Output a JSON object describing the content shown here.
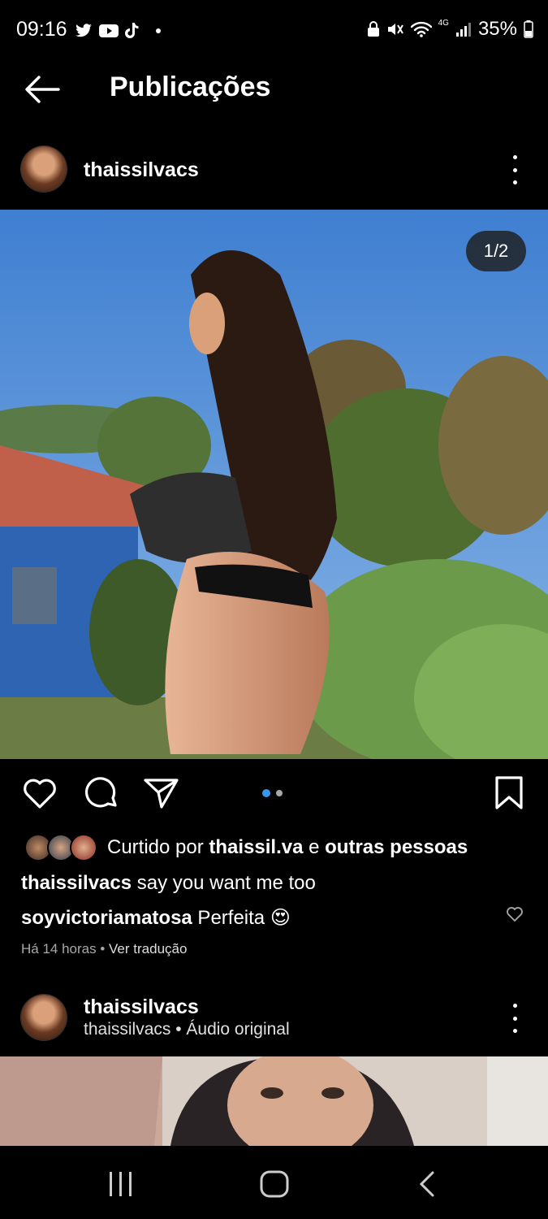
{
  "status_bar": {
    "time": "09:16",
    "battery": "35%",
    "network": "4G"
  },
  "header": {
    "title": "Publicações"
  },
  "post": {
    "username": "thaissilvacs",
    "image_counter": "1/2",
    "carousel": {
      "count": 2,
      "active": 0
    },
    "likes": {
      "prefix": "Curtido por ",
      "liker": "thaissil.va",
      "joiner": " e ",
      "others": "outras pessoas"
    },
    "caption": {
      "username": "thaissilvacs",
      "text": " say you want me too"
    },
    "comment": {
      "username": "soyvictoriamatosa",
      "text": " Perfeita 😍"
    },
    "timestamp": "Há 14 horas",
    "separator": " • ",
    "translate": "Ver tradução"
  },
  "next_post": {
    "username": "thaissilvacs",
    "audio": "thaissilvacs • Áudio original"
  },
  "colors": {
    "background": "#000000",
    "accent_blue": "#3897f0",
    "dim_text": "#a8a8a8"
  },
  "icons": [
    "back-arrow-icon",
    "heart-icon",
    "comment-icon",
    "share-icon",
    "bookmark-icon",
    "more-icon",
    "wifi-icon",
    "battery-icon"
  ]
}
